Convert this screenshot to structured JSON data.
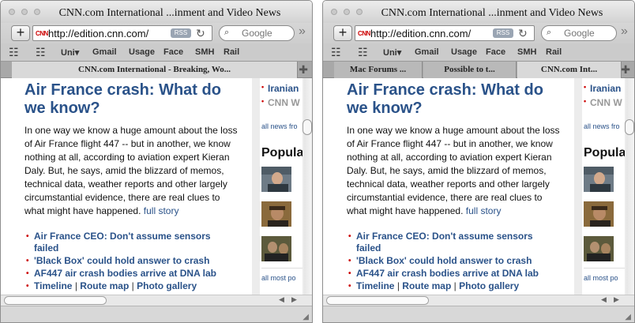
{
  "window": {
    "title": "CNN.com International ...inment and Video News",
    "url": "http://edition.cnn.com/",
    "favicon_text": "CNN",
    "rss_label": "RSS",
    "search_placeholder": "Google"
  },
  "bookmarks": [
    "Uni▾",
    "Gmail",
    "Usage",
    "Face",
    "SMH",
    "Rail"
  ],
  "tabs_left": [
    "CNN.com International - Breaking, Wo..."
  ],
  "tabs_right": [
    "Mac Forums ...",
    "Possible to t...",
    "CNN.com Int..."
  ],
  "article": {
    "headline": "Air France crash: What do we know?",
    "body": "In one way we know a huge amount about the loss of Air France flight 447 -- but in another, we know nothing at all, according to aviation expert Kieran Daly. But, he says, amid the blizzard of memos, technical data, weather reports and other largely circumstantial evidence, there are real clues to what might have happened.",
    "full_story": "full story",
    "related": [
      "Air France CEO: Don't assume sensors failed",
      "'Black Box' could hold answer to crash",
      "AF447 air crash bodies arrive at DNA lab"
    ],
    "timeline": "Timeline",
    "route_map": "Route map",
    "photo_gallery": "Photo gallery",
    "separator": "|"
  },
  "sidebar": {
    "link1": "Iranian",
    "link2": "CNN W",
    "all_news": "all news fro",
    "popular": "Popula",
    "all_most_popular": "all most po"
  },
  "colors": {
    "headline": "#2a5289",
    "bullet": "#cc0000"
  },
  "icons": {
    "add_bookmark": "+",
    "reload": "↻",
    "search": "⌕",
    "more": "»",
    "bookmarks_book": "☷",
    "grid": "☷",
    "new_tab": "✚",
    "scroll_left": "◀",
    "scroll_right": "▶",
    "resize": "◢"
  }
}
